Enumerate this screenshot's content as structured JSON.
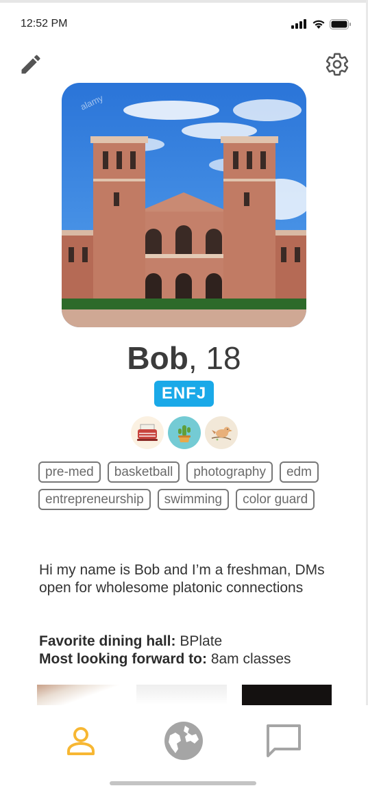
{
  "status_bar": {
    "time": "12:52 PM"
  },
  "icons": {
    "edit": "pencil-icon",
    "settings": "gear-icon",
    "profile_tab": "person-icon",
    "explore_tab": "globe-icon",
    "messages_tab": "chat-bubble-icon"
  },
  "profile": {
    "photo_watermark": "alamy",
    "name": "Bob",
    "age_text": ", 18",
    "personality_type": "ENFJ",
    "badges": [
      "typewriter-icon",
      "cactus-icon",
      "bird-icon"
    ],
    "interests": [
      "pre-med",
      "basketball",
      "photography",
      "edm",
      "entrepreneurship",
      "swimming",
      "color guard"
    ],
    "bio": "Hi my name is Bob and I’m a freshman, DMs open for wholesome platonic connections",
    "facts": [
      {
        "label": "Favorite dining hall:",
        "value": "BPlate"
      },
      {
        "label": "Most looking forward to:",
        "value": "8am classes"
      }
    ]
  },
  "colors": {
    "accent_blue": "#1aa9e8",
    "active_tab": "#f7b733",
    "inactive_tab": "#a5a5a5",
    "tag_border": "#777777"
  },
  "tabs": {
    "active": "profile"
  }
}
